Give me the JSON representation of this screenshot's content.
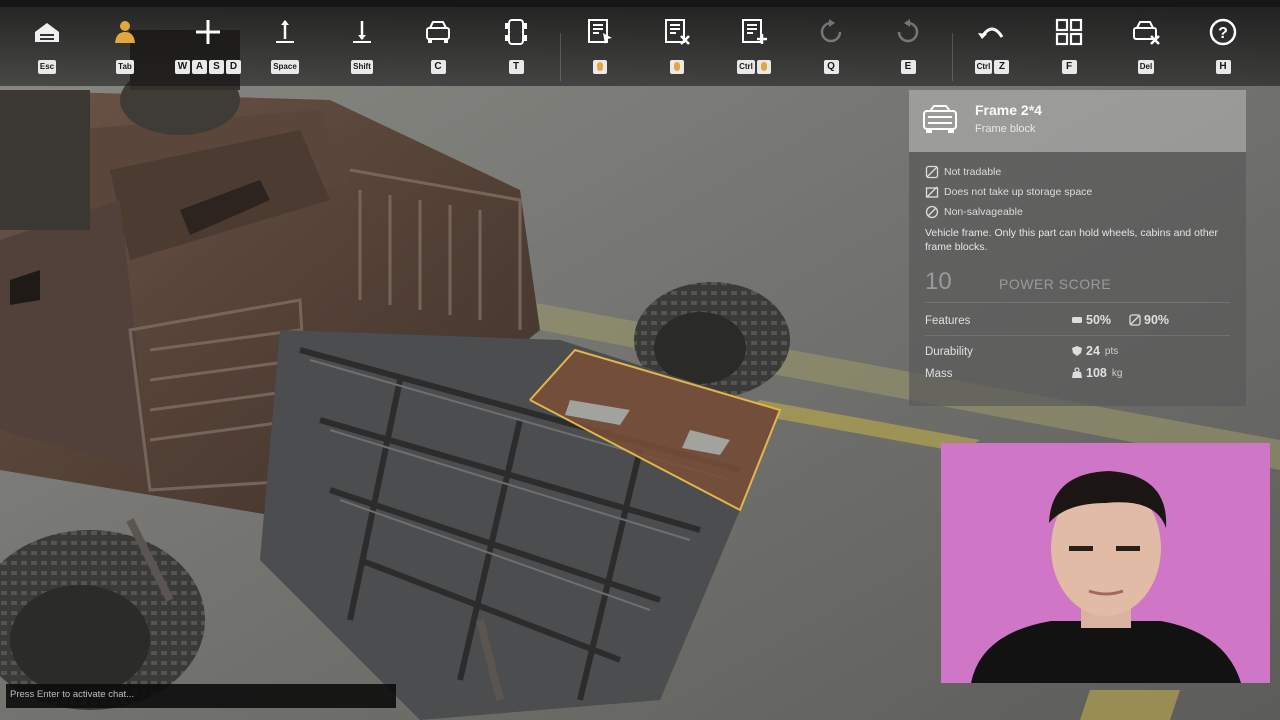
{
  "toolbar": {
    "tools": [
      {
        "icon": "garage-icon",
        "keys": [
          "Esc"
        ]
      },
      {
        "icon": "crew-icon",
        "keys": [
          "Tab"
        ]
      },
      {
        "icon": "move-icon",
        "keys": [
          "W",
          "A",
          "S",
          "D"
        ]
      },
      {
        "icon": "raise-icon",
        "keys": [
          "Space"
        ]
      },
      {
        "icon": "lower-icon",
        "keys": [
          "Shift"
        ]
      },
      {
        "icon": "vehicle-front-icon",
        "keys": [
          "C"
        ]
      },
      {
        "icon": "vehicle-top-icon",
        "keys": [
          "T"
        ]
      },
      {
        "icon": "select-part-icon",
        "keys": []
      },
      {
        "icon": "delete-part-icon",
        "keys": []
      },
      {
        "icon": "add-part-icon",
        "keys": [
          "Ctrl"
        ]
      },
      {
        "icon": "rotate-left-icon",
        "keys": [
          "Q"
        ]
      },
      {
        "icon": "rotate-right-icon",
        "keys": [
          "E"
        ]
      },
      {
        "icon": "undo-icon",
        "keys": [
          "Ctrl",
          "Z"
        ]
      },
      {
        "icon": "grid-icon",
        "keys": [
          "F"
        ]
      },
      {
        "icon": "delete-vehicle-icon",
        "keys": [
          "Del"
        ]
      },
      {
        "icon": "help-icon",
        "keys": [
          "H"
        ]
      }
    ]
  },
  "part": {
    "name": "Frame 2*4",
    "category": "Frame block",
    "properties": [
      {
        "icon": "not-tradable-icon",
        "text": "Not tradable"
      },
      {
        "icon": "no-storage-icon",
        "text": "Does not take up storage space"
      },
      {
        "icon": "non-salvageable-icon",
        "text": "Non-salvageable"
      }
    ],
    "description": "Vehicle frame. Only this part can hold wheels, cabins and other frame blocks.",
    "power_score": "10",
    "power_score_label": "POWER SCORE",
    "features_label": "Features",
    "feature_values": [
      "50%",
      "90%"
    ],
    "durability_label": "Durability",
    "durability_value": "24",
    "durability_unit": "pts",
    "mass_label": "Mass",
    "mass_value": "108",
    "mass_unit": "kg"
  },
  "chat": {
    "placeholder": "Press Enter to activate chat..."
  },
  "colors": {
    "highlight": "#e2b54a",
    "webcam_bg": "#cf76c6"
  }
}
